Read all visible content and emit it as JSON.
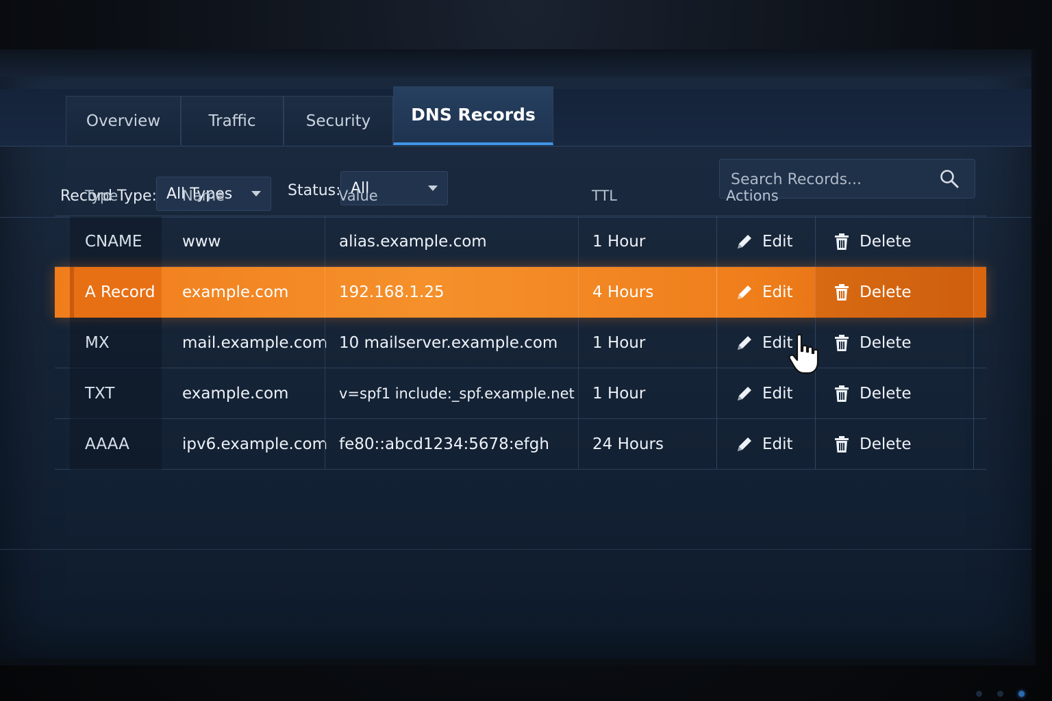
{
  "tabs": [
    {
      "label": "Overview"
    },
    {
      "label": "Traffic"
    },
    {
      "label": "Security"
    },
    {
      "label": "DNS Records",
      "active": true
    }
  ],
  "filters": {
    "record_type_label": "Record Type:",
    "record_type_value": "All Types",
    "status_label": "Status:",
    "status_value": "All",
    "search_placeholder": "Search Records..."
  },
  "table": {
    "headers": {
      "type": "Type",
      "name": "Name",
      "value": "Value",
      "ttl": "TTL",
      "actions": "Actions"
    },
    "rows": [
      {
        "type": "CNAME",
        "name": "www",
        "value": "alias.example.com",
        "ttl": "1 Hour",
        "edit": "Edit",
        "delete": "Delete"
      },
      {
        "type": "A Record",
        "name": "example.com",
        "value": "192.168.1.25",
        "ttl": "4 Hours",
        "edit": "Edit",
        "delete": "Delete",
        "highlighted": true
      },
      {
        "type": "MX",
        "name": "mail.example.com",
        "value": "10 mailserver.example.com",
        "ttl": "1 Hour",
        "edit": "Edit",
        "delete": "Delete"
      },
      {
        "type": "TXT",
        "name": "example.com",
        "value": "v=spf1 include:_spf.example.net",
        "ttl": "1 Hour",
        "edit": "Edit",
        "delete": "Delete"
      },
      {
        "type": "AAAA",
        "name": "ipv6.example.com",
        "value": "fe80::abcd1234:5678:efgh",
        "ttl": "24 Hours",
        "edit": "Edit",
        "delete": "Delete"
      }
    ]
  },
  "icons": {
    "search": "search-icon",
    "edit": "pencil-icon",
    "delete": "trash-icon",
    "cursor": "hand-pointer-icon",
    "dropdown": "chevron-down-icon"
  },
  "colors": {
    "accent": "#3f95e6",
    "highlight": "#f07d1b",
    "background": "#172538"
  }
}
